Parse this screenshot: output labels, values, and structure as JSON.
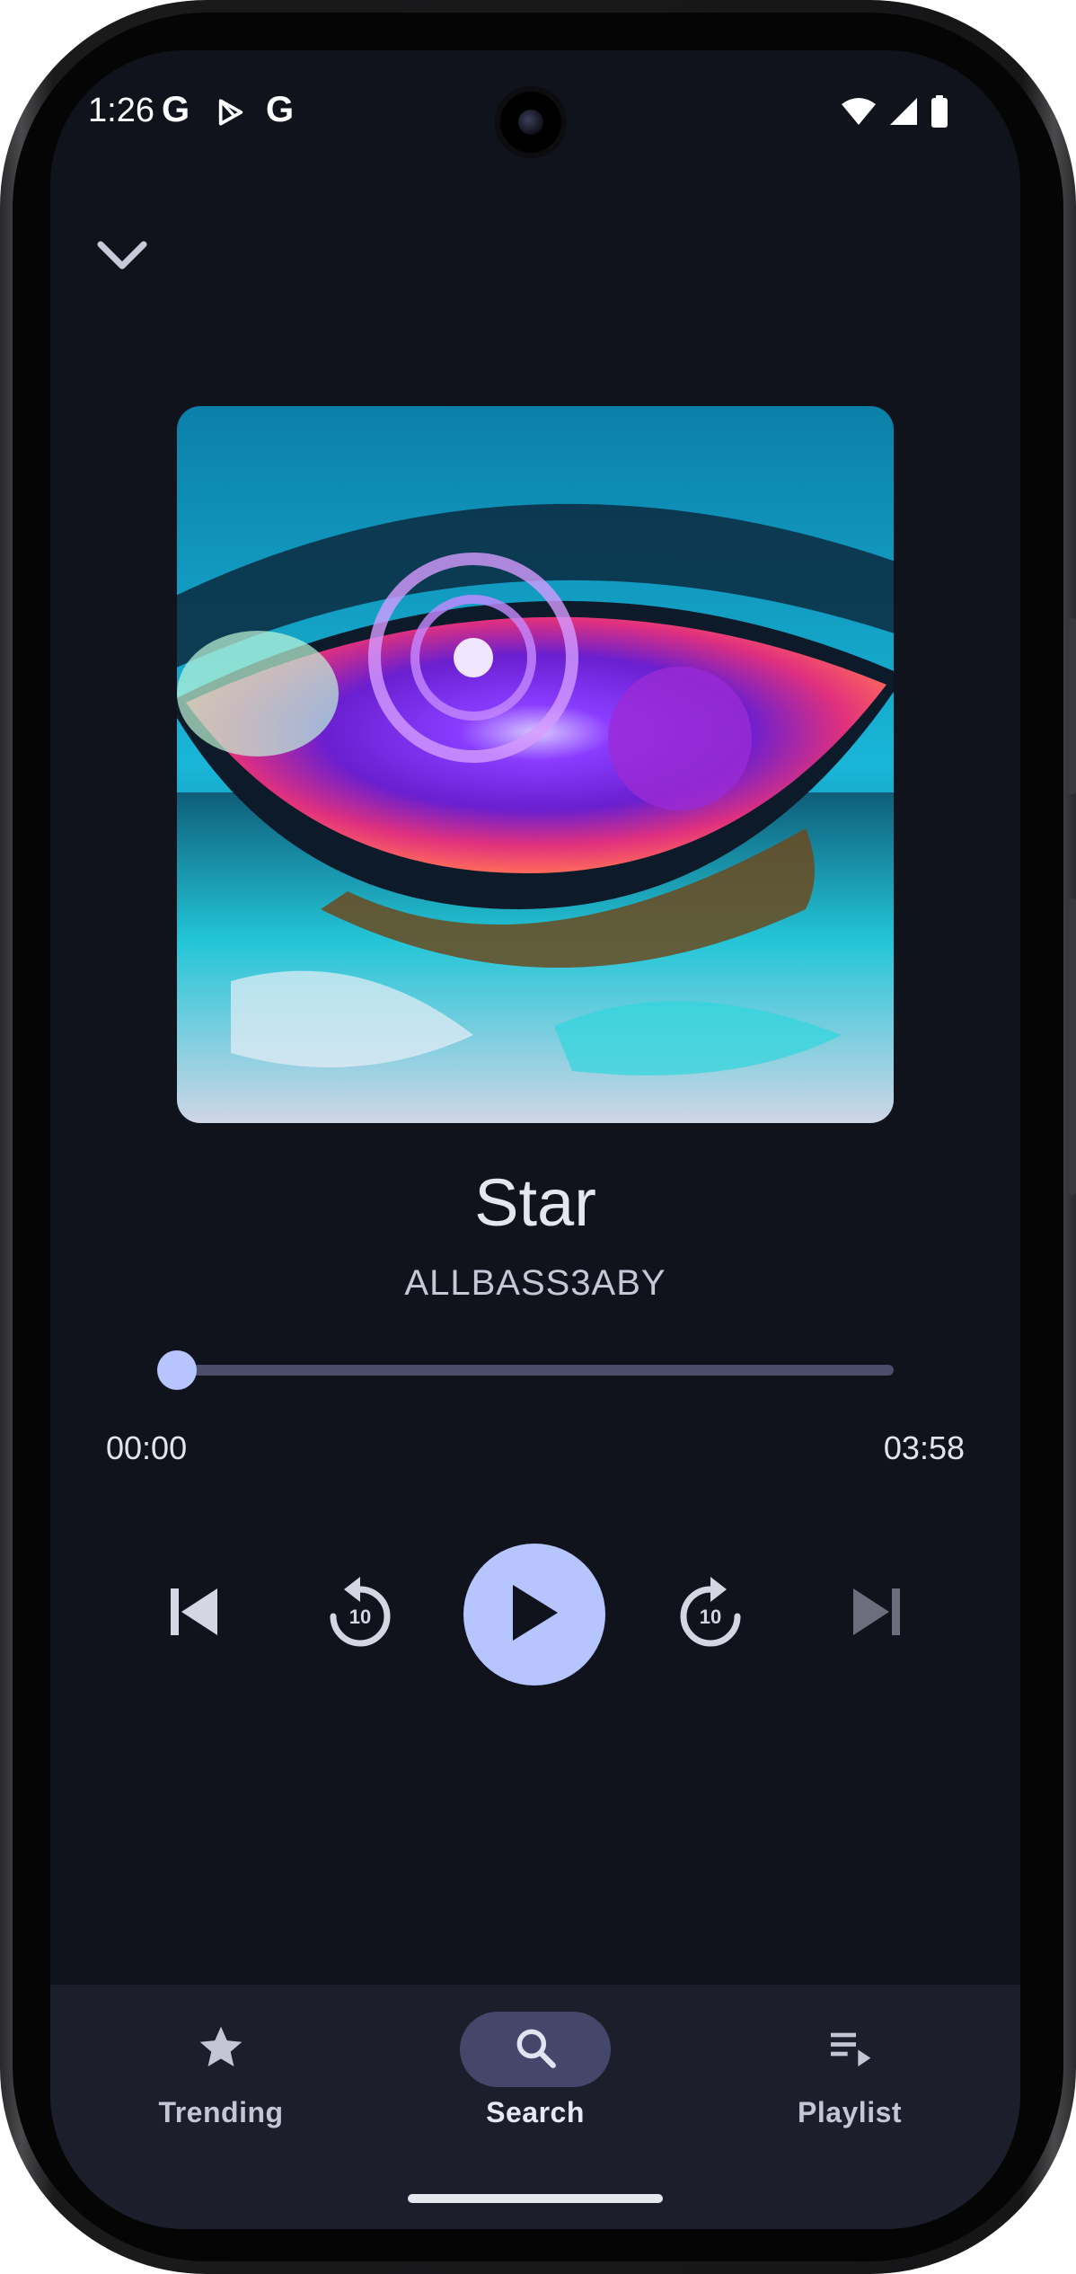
{
  "status_bar": {
    "time": "1:26",
    "notif_icons": [
      "google-g-icon",
      "play-store-icon",
      "google-g-icon"
    ],
    "system_icons": [
      "wifi-icon",
      "signal-icon",
      "battery-icon"
    ]
  },
  "player": {
    "title": "Star",
    "artist": "ALLBASS3ABY",
    "elapsed": "00:00",
    "duration": "03:58",
    "progress": 0.0
  },
  "controls": [
    "skip-previous-icon",
    "replay-10-icon",
    "play-icon",
    "forward-10-icon",
    "skip-next-icon"
  ],
  "replay_label": "10",
  "forward_label": "10",
  "nav": {
    "items": [
      {
        "label": "Trending",
        "icon": "star-icon",
        "active": false
      },
      {
        "label": "Search",
        "icon": "search-icon",
        "active": true
      },
      {
        "label": "Playlist",
        "icon": "playlist-play-icon",
        "active": false
      }
    ]
  },
  "colors": {
    "background": "#11131c",
    "accent": "#b6c4ff",
    "nav_background": "#1c1e2c",
    "active_pill": "#44476a"
  }
}
